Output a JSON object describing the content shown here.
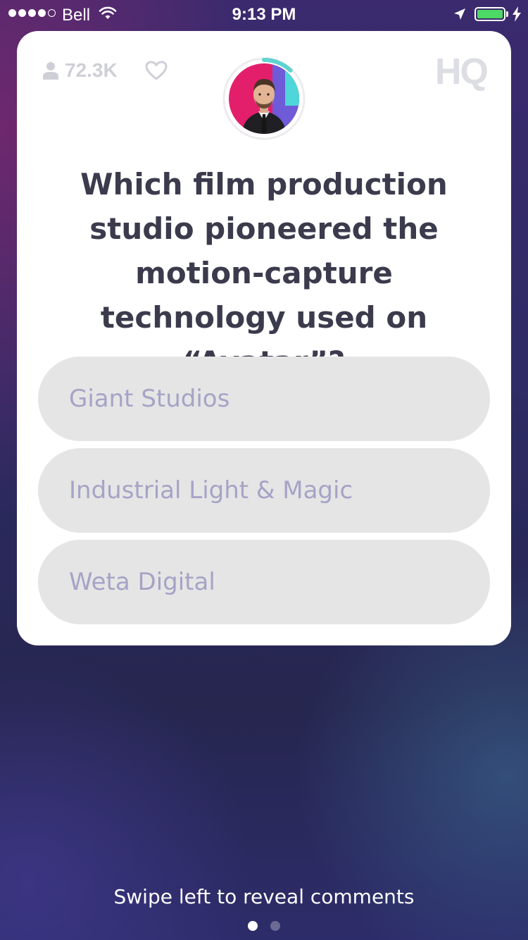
{
  "status_bar": {
    "carrier": "Bell",
    "time": "9:13 PM",
    "signal_bars_filled": 4,
    "signal_bars_total": 5,
    "battery_level_percent": 100,
    "battery_color": "#4cd964",
    "charging": true
  },
  "card": {
    "viewer_count": "72.3K",
    "logo_text": "HQ",
    "host_timer_remaining_fraction": 0.12,
    "question": "Which film production studio pioneered the motion-capture technology used on “Avatar”?",
    "answers": [
      {
        "label": "Giant Studios"
      },
      {
        "label": "Industrial Light & Magic"
      },
      {
        "label": "Weta Digital"
      }
    ]
  },
  "footer": {
    "hint": "Swipe left to reveal comments",
    "page_count": 2,
    "active_page": 1
  },
  "colors": {
    "question_text": "#3b3b4d",
    "answer_bg": "#e5e5e5",
    "answer_text": "#a6a3c6",
    "timer_ring": "#5fd3d0"
  },
  "icons": [
    "person-icon",
    "heart-icon",
    "wifi-icon",
    "location-arrow-icon",
    "battery-icon",
    "charging-bolt-icon"
  ]
}
